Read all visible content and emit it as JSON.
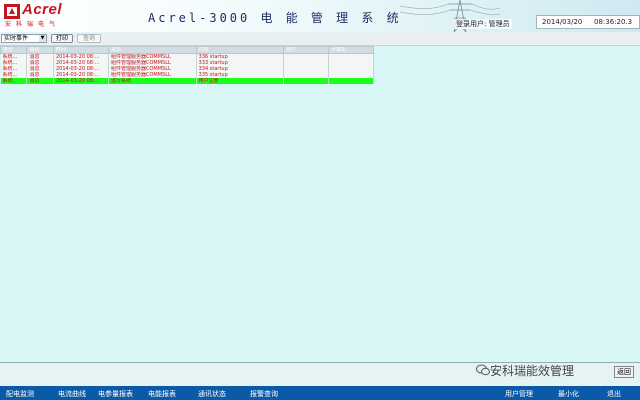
{
  "header": {
    "brand": "Acrel",
    "brand_sub": "安科瑞电气",
    "title": "Acrel-3000 电 能 管 理 系 统",
    "login_text": "登录用户: 管理员",
    "date": "2014/03/20",
    "time": "08:36:20.3"
  },
  "toolbar": {
    "select_value": "实时事件",
    "print_label": "打印",
    "query_label": "查询"
  },
  "table": {
    "columns": [
      "类型",
      "级别",
      "时间",
      "来源",
      "内容",
      "用户",
      "计算机"
    ],
    "rows": [
      {
        "type": "系统...",
        "level": "消息",
        "time": "2014-03-20 08:...",
        "source": "组件管理服务器COMMSLL",
        "content": "336 startup",
        "user": "",
        "pc": ""
      },
      {
        "type": "系统...",
        "level": "消息",
        "time": "2014-03-20 08:...",
        "source": "组件管理服务器COMMSLL",
        "content": "333 startup",
        "user": "",
        "pc": ""
      },
      {
        "type": "系统...",
        "level": "消息",
        "time": "2014-03-20 08:...",
        "source": "组件管理服务器COMMSLL",
        "content": "334 startup",
        "user": "",
        "pc": ""
      },
      {
        "type": "系统...",
        "level": "消息",
        "time": "2014-03-20 08:...",
        "source": "组件管理服务器COMMSLL",
        "content": "335 startup",
        "user": "",
        "pc": ""
      },
      {
        "type": "系统...",
        "level": "消息",
        "time": "2014-03-20 08:...",
        "source": "运行系统",
        "content": "用户注册",
        "user": "",
        "pc": "",
        "highlight": true
      }
    ]
  },
  "watermark": "安科瑞能效管理",
  "return_label": "返回",
  "nav": {
    "items": [
      "配电监测",
      "电流曲线",
      "电参量报表",
      "电能报表",
      "通讯状态",
      "报警查询"
    ],
    "right_items": [
      "用户管理",
      "最小化",
      "退出"
    ]
  },
  "colors": {
    "accent": "#0b5aa8",
    "content_bg": "#d8f6f6",
    "highlight_row": "#1aff1a",
    "row_text": "#c0161c"
  }
}
